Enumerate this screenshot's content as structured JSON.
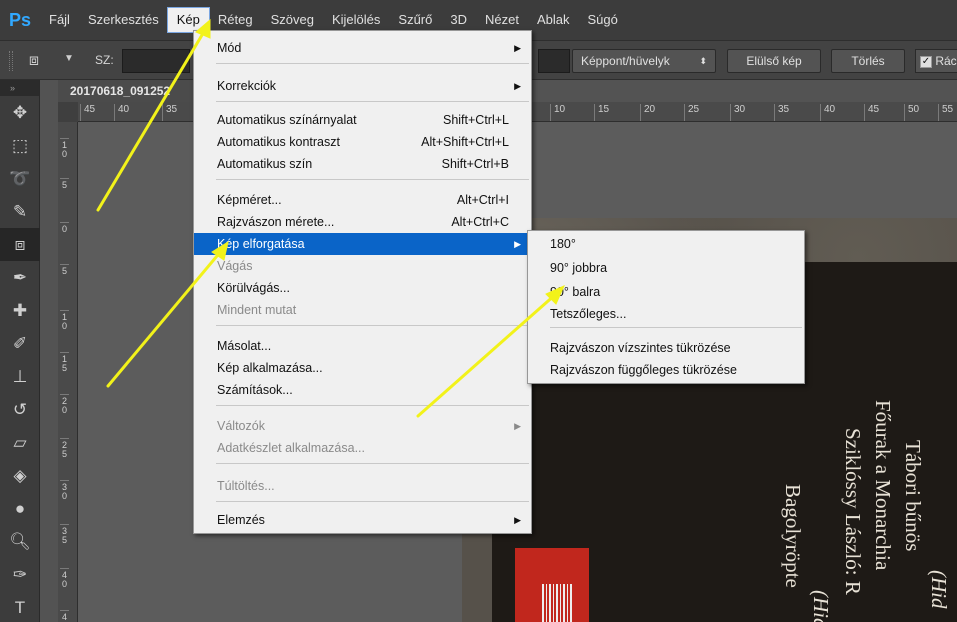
{
  "menubar": {
    "logo": "Ps",
    "items": [
      "Fájl",
      "Szerkesztés",
      "Kép",
      "Réteg",
      "Szöveg",
      "Kijelölés",
      "Szűrő",
      "3D",
      "Nézet",
      "Ablak",
      "Súgó"
    ],
    "active_item": "Kép"
  },
  "options": {
    "sz_label": "SZ:",
    "unit": "Képpont/hüvelyk",
    "front_image": "Elülső kép",
    "clear": "Törlés",
    "checkbox_label": "Rác"
  },
  "document": {
    "tab_title": "20170618_091252",
    "ruler_top": [
      "45",
      "40",
      "35",
      "10",
      "15",
      "20",
      "25",
      "30",
      "35",
      "40",
      "45",
      "50",
      "55"
    ],
    "ruler_left": [
      "1 0",
      "5",
      "0",
      "5",
      "1 0",
      "1 5",
      "2 0",
      "2 5",
      "3 0",
      "3 5",
      "4 0",
      "4"
    ]
  },
  "book": {
    "lines": [
      "(Hid",
      "Tábori bűnös",
      "Főurak a Monarchia",
      "Sziklóssy László: R",
      "(Hid",
      "Bagolyröpte"
    ]
  },
  "kep_menu": {
    "items": [
      {
        "label": "Mód",
        "submenu": true
      },
      {
        "label": "Korrekciók",
        "submenu": true
      },
      {
        "label": "Automatikus színárnyalat",
        "shortcut": "Shift+Ctrl+L"
      },
      {
        "label": "Automatikus kontraszt",
        "shortcut": "Alt+Shift+Ctrl+L"
      },
      {
        "label": "Automatikus szín",
        "shortcut": "Shift+Ctrl+B"
      },
      {
        "label": "Képméret...",
        "shortcut": "Alt+Ctrl+I"
      },
      {
        "label": "Rajzvászon mérete...",
        "shortcut": "Alt+Ctrl+C"
      },
      {
        "label": "Kép elforgatása",
        "submenu": true,
        "highlighted": true
      },
      {
        "label": "Vágás",
        "disabled": true
      },
      {
        "label": "Körülvágás..."
      },
      {
        "label": "Mindent mutat",
        "disabled": true
      },
      {
        "label": "Másolat..."
      },
      {
        "label": "Kép alkalmazása..."
      },
      {
        "label": "Számítások..."
      },
      {
        "label": "Változók",
        "submenu": true,
        "disabled": true
      },
      {
        "label": "Adatkészlet alkalmazása...",
        "disabled": true
      },
      {
        "label": "Túltöltés...",
        "disabled": true
      },
      {
        "label": "Elemzés",
        "submenu": true
      }
    ]
  },
  "rotate_menu": {
    "items": [
      "180°",
      "90° jobbra",
      "90° balra",
      "Tetszőleges...",
      "Rajzvászon vízszintes tükrözése",
      "Rajzvászon függőleges tükrözése"
    ]
  },
  "colors": {
    "highlight": "#0a64c8",
    "arrow": "#f2f21a",
    "ps_blue": "#31a8ff"
  }
}
